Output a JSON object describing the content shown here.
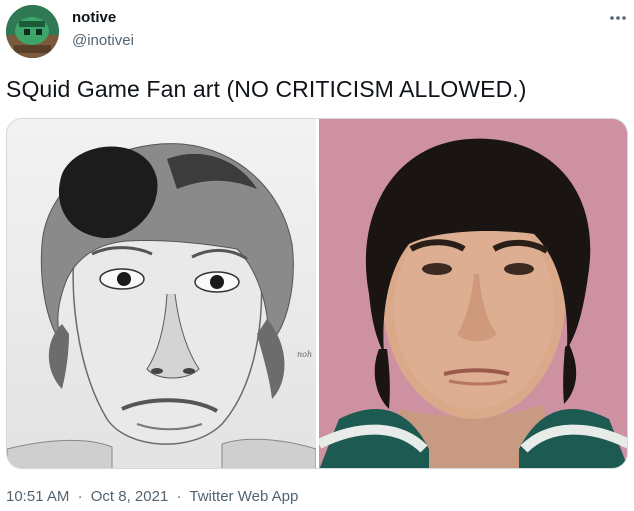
{
  "author": {
    "display_name": "notive",
    "handle": "@inotivei"
  },
  "tweet": {
    "text": "SQuid Game Fan art (NO CRITICISM ALLOWED.)"
  },
  "media": {
    "left_image": "pencil-sketch-portrait",
    "right_image": "actor-headshot-photo",
    "sketch_signature": "noh"
  },
  "meta": {
    "time": "10:51 AM",
    "date": "Oct 8, 2021",
    "separator": "·",
    "source": "Twitter Web App"
  },
  "colors": {
    "text": "#0f1419",
    "secondary": "#536471",
    "border": "#cfd9de",
    "photo_background": "#c98b9c"
  }
}
